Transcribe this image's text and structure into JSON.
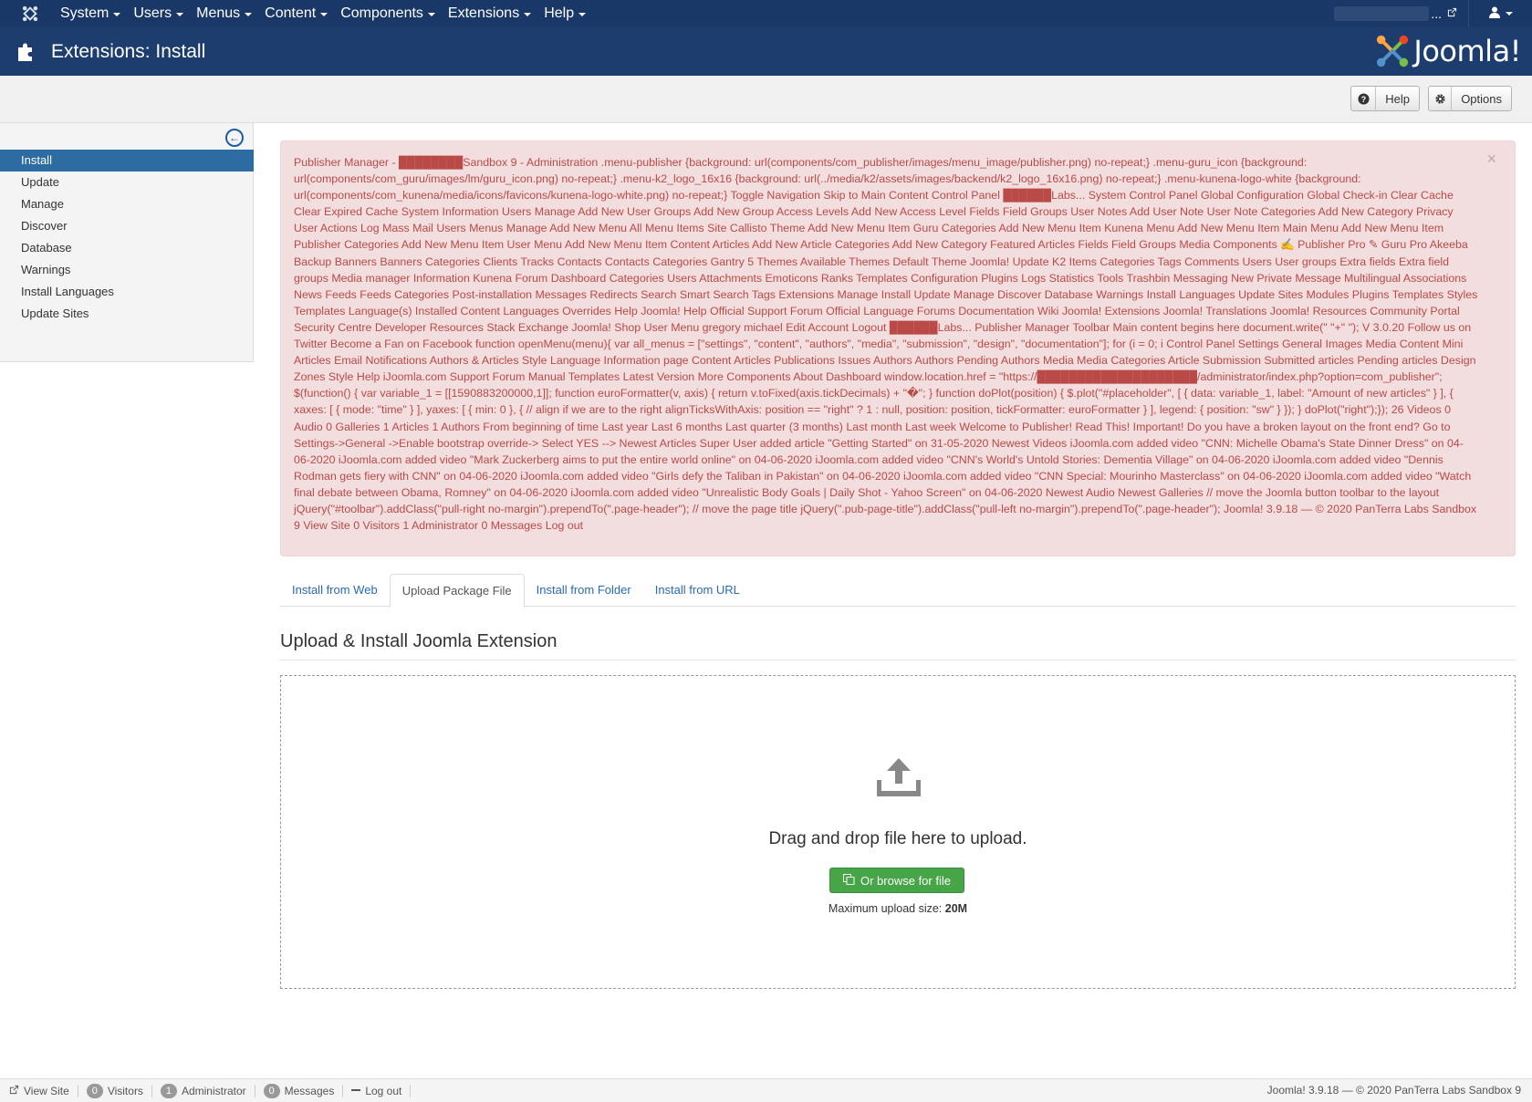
{
  "nav": {
    "items": [
      {
        "label": "System"
      },
      {
        "label": "Users"
      },
      {
        "label": "Menus"
      },
      {
        "label": "Content"
      },
      {
        "label": "Components"
      },
      {
        "label": "Extensions"
      },
      {
        "label": "Help"
      }
    ],
    "site_label": "..."
  },
  "header": {
    "title": "Extensions: Install",
    "brand": "Joomla!"
  },
  "toolbar": {
    "help_label": "Help",
    "options_label": "Options"
  },
  "sidebar": {
    "items": [
      {
        "label": "Install",
        "active": true
      },
      {
        "label": "Update"
      },
      {
        "label": "Manage"
      },
      {
        "label": "Discover"
      },
      {
        "label": "Database"
      },
      {
        "label": "Warnings"
      },
      {
        "label": "Install Languages"
      },
      {
        "label": "Update Sites"
      }
    ]
  },
  "alert": {
    "text": "Publisher Manager - ████████Sandbox 9 - Administration .menu-publisher {background: url(components/com_publisher/images/menu_image/publisher.png) no-repeat;} .menu-guru_icon {background: url(components/com_guru/images/lm/guru_icon.png) no-repeat;} .menu-k2_logo_16x16 {background: url(../media/k2/assets/images/backend/k2_logo_16x16.png) no-repeat;} .menu-kunena-logo-white {background: url(components/com_kunena/media/icons/favicons/kunena-logo-white.png) no-repeat;} Toggle Navigation Skip to Main Content Control Panel ██████Labs... System Control Panel Global Configuration Global Check-in Clear Cache Clear Expired Cache System Information Users Manage Add New User Groups Add New Group Access Levels Add New Access Level Fields Field Groups User Notes Add User Note User Note Categories Add New Category Privacy User Actions Log Mass Mail Users Menus Manage Add New Menu All Menu Items Site Callisto Theme Add New Menu Item Guru Categories Add New Menu Item Kunena Menu Add New Menu Item Main Menu Add New Menu Item Publisher Categories Add New Menu Item User Menu Add New Menu Item Content Articles Add New Article Categories Add New Category Featured Articles Fields Field Groups Media Components ✍ Publisher Pro ✎ Guru Pro Akeeba Backup Banners Banners Categories Clients Tracks Contacts Contacts Categories Gantry 5 Themes Available Themes Default Theme Joomla! Update K2 Items Categories Tags Comments Users User groups Extra fields Extra field groups Media manager Information Kunena Forum Dashboard Categories Users Attachments Emoticons Ranks Templates Configuration Plugins Logs Statistics Tools Trashbin Messaging New Private Message Multilingual Associations News Feeds Feeds Categories Post-installation Messages Redirects Search Smart Search Tags Extensions Manage Install Update Manage Discover Database Warnings Install Languages Update Sites Modules Plugins Templates Styles Templates Language(s) Installed Content Languages Overrides Help Joomla! Help Official Support Forum Official Language Forums Documentation Wiki Joomla! Extensions Joomla! Translations Joomla! Resources Community Portal Security Centre Developer Resources Stack Exchange Joomla! Shop User Menu gregory michael Edit Account Logout ██████Labs... Publisher Manager Toolbar Main content begins here document.write(\" \"+\" \"); V 3.0.20 Follow us on Twitter Become a Fan on Facebook function openMenu(menu){ var all_menus = [\"settings\", \"content\", \"authors\", \"media\", \"submission\", \"design\", \"documentation\"]; for (i = 0; i Control Panel Settings General Images Media Content Mini Articles Email Notifications Authors & Articles Style Language Information page Content Articles Publications Issues Authors Authors Pending Authors Media Media Categories Article Submission Submitted articles Pending articles Design Zones Style Help iJoomla.com Support Forum Manual Templates Latest Version More Components About Dashboard window.location.href = \"https://████████████████████/administrator/index.php?option=com_publisher\"; $(function() { var variable_1 = [[1590883200000,1]]; function euroFormatter(v, axis) { return v.toFixed(axis.tickDecimals) + \"�\"; } function doPlot(position) { $.plot(\"#placeholder\", [ { data: variable_1, label: \"Amount of new articles\" } ], { xaxes: [ { mode: \"time\" } ], yaxes: [ { min: 0 }, { // align if we are to the right alignTicksWithAxis: position == \"right\" ? 1 : null, position: position, tickFormatter: euroFormatter } ], legend: { position: \"sw\" } }); } doPlot(\"right\");}); 26 Videos 0 Audio 0 Galleries 1 Articles 1 Authors From beginning of time Last year Last 6 months Last quarter (3 months) Last month Last week Welcome to Publisher! Read This! Important! Do you have a broken layout on the front end? Go to Settings->General ->Enable bootstrap override-> Select YES --> Newest Articles Super User added article \"Getting Started\" on 31-05-2020 Newest Videos iJoomla.com added video \"CNN: Michelle Obama's State Dinner Dress\" on 04-06-2020 iJoomla.com added video \"Mark Zuckerberg aims to put the entire world online\" on 04-06-2020 iJoomla.com added video \"CNN's World's Untold Stories: Dementia Village\" on 04-06-2020 iJoomla.com added video \"Dennis Rodman gets fiery with CNN\" on 04-06-2020 iJoomla.com added video \"Girls defy the Taliban in Pakistan\" on 04-06-2020 iJoomla.com added video \"CNN Special: Mourinho Masterclass\" on 04-06-2020 iJoomla.com added video \"Watch final debate between Obama, Romney\" on 04-06-2020 iJoomla.com added video \"Unrealistic Body Goals | Daily Shot - Yahoo Screen\" on 04-06-2020 Newest Audio Newest Galleries // move the Joomla button toolbar to the layout jQuery(\"#toolbar\").addClass(\"pull-right no-margin\").prependTo(\".page-header\"); // move the page title jQuery(\".pub-page-title\").addClass(\"pull-left no-margin\").prependTo(\".page-header\"); Joomla! 3.9.18 — © 2020 PanTerra Labs Sandbox 9 View Site 0 Visitors 1 Administrator 0 Messages Log out"
  },
  "tabs": [
    {
      "label": "Install from Web"
    },
    {
      "label": "Upload Package File",
      "active": true
    },
    {
      "label": "Install from Folder"
    },
    {
      "label": "Install from URL"
    }
  ],
  "upload": {
    "title": "Upload & Install Joomla Extension",
    "drag_text": "Drag and drop file here to upload.",
    "browse_label": "Or browse for file",
    "max_label": "Maximum upload size: ",
    "max_value": "20M"
  },
  "statusbar": {
    "view_site": "View Site",
    "visitors_count": "0",
    "visitors_label": "Visitors",
    "admin_count": "1",
    "admin_label": "Administrator",
    "messages_count": "0",
    "messages_label": "Messages",
    "logout": "Log out",
    "right": "Joomla! 3.9.18  —  © 2020 PanTerra Labs Sandbox 9"
  },
  "colors": {
    "navbar": "#1a3867",
    "header": "#1c3d6e",
    "active_sidebar": "#2d6ca2",
    "alert_bg": "#f2dede",
    "alert_text": "#b94a48",
    "browse_button": "#46a546"
  }
}
